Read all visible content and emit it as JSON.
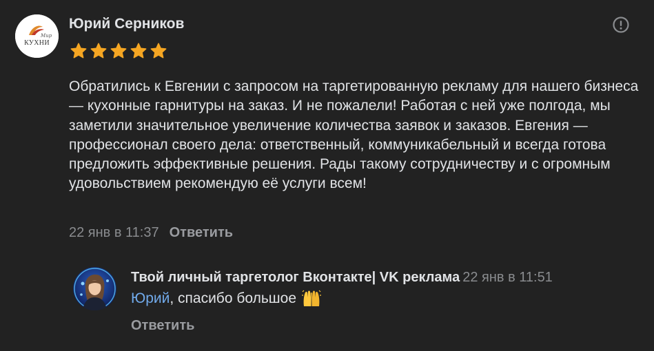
{
  "comment": {
    "author": "Юрий Серников",
    "avatar_icon": "kuhni-logo",
    "avatar_text": "КУХНИ",
    "avatar_script": "Мир",
    "rating": 5,
    "text": "Обратились к Евгении с запросом на таргетированную рекламу для нашего бизнеса — кухонные гарнитуры на заказ. И не пожалели! Работая с ней уже полгода, мы заметили значительное увеличение количества заявок и заказов. Евгения — профессионал своего дела: ответственный, коммуникабельный и всегда готова предложить эффективные решения. Рады такому сотрудничеству и с огромным удовольствием рекомендую её услуги всем!",
    "timestamp": "22 янв в 11:37",
    "reply_label": "Ответить",
    "report_icon": "exclamation-circle-icon"
  },
  "reply": {
    "author": "Твой личный таргетолог Вконтакте| VK реклама",
    "timestamp": "22 янв в 11:51",
    "mention": "Юрий",
    "text": ", спасибо большое",
    "emoji": "raising-hands",
    "reply_label": "Ответить"
  },
  "colors": {
    "background": "#222222",
    "text": "#e1e3e6",
    "secondary": "#8a8c8f",
    "link": "#71aaeb",
    "star": "#f5a623"
  }
}
